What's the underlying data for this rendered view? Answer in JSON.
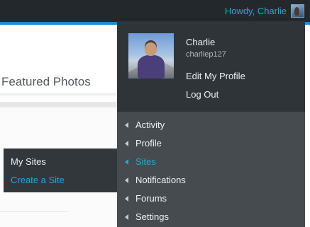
{
  "admin_bar": {
    "greeting": "Howdy, Charlie",
    "avatar_icon": "user-avatar-icon",
    "accent_color": "#1d8ad0",
    "link_color": "#2ea2cc"
  },
  "page": {
    "heading": "Featured Photos"
  },
  "sites_submenu": {
    "items": [
      {
        "label": "My Sites"
      },
      {
        "label": "Create a Site"
      }
    ]
  },
  "account_menu": {
    "name": "Charlie",
    "username": "charliep127",
    "links": [
      {
        "label": "Edit My Profile"
      },
      {
        "label": "Log Out"
      }
    ],
    "nav_items": [
      {
        "label": "Activity",
        "icon": "chevron-left-icon"
      },
      {
        "label": "Profile",
        "icon": "chevron-left-icon"
      },
      {
        "label": "Sites",
        "icon": "chevron-left-icon",
        "active": true
      },
      {
        "label": "Notifications",
        "icon": "chevron-left-icon"
      },
      {
        "label": "Forums",
        "icon": "chevron-left-icon"
      },
      {
        "label": "Settings",
        "icon": "chevron-left-icon"
      }
    ]
  }
}
